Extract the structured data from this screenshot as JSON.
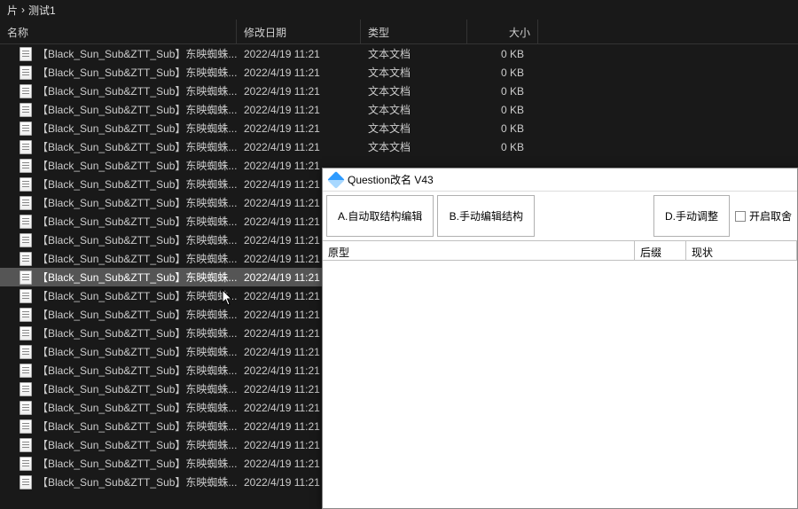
{
  "breadcrumb": {
    "prefix": "片",
    "sep": "›",
    "folder": "测试1"
  },
  "columns": {
    "name": "名称",
    "date": "修改日期",
    "type": "类型",
    "size": "大小"
  },
  "file_defaults": {
    "name": "【Black_Sun_Sub&ZTT_Sub】东映蜘蛛...",
    "date_full": "2022/4/19 11:21",
    "date_cut": "2022/4/19 11:21",
    "type": "文本文档",
    "size": "0 KB"
  },
  "files": [
    {
      "full": true
    },
    {
      "full": true
    },
    {
      "full": true
    },
    {
      "full": true
    },
    {
      "full": true
    },
    {
      "full": true
    },
    {
      "full": false
    },
    {
      "full": false
    },
    {
      "full": false
    },
    {
      "full": false
    },
    {
      "full": false
    },
    {
      "full": false
    },
    {
      "full": false,
      "selected": true
    },
    {
      "full": false
    },
    {
      "full": false
    },
    {
      "full": false
    },
    {
      "full": false
    },
    {
      "full": false
    },
    {
      "full": false
    },
    {
      "full": false
    },
    {
      "full": false
    },
    {
      "full": false
    },
    {
      "full": false
    },
    {
      "full": false
    }
  ],
  "rename_window": {
    "title": "Question改名 V43",
    "buttons": {
      "a": "A.自动取结构编辑",
      "b": "B.手动编辑结构",
      "d": "D.手动调整"
    },
    "checkbox_label": "开启取舍",
    "table": {
      "proto": "原型",
      "suffix": "后缀",
      "status": "现状"
    }
  }
}
